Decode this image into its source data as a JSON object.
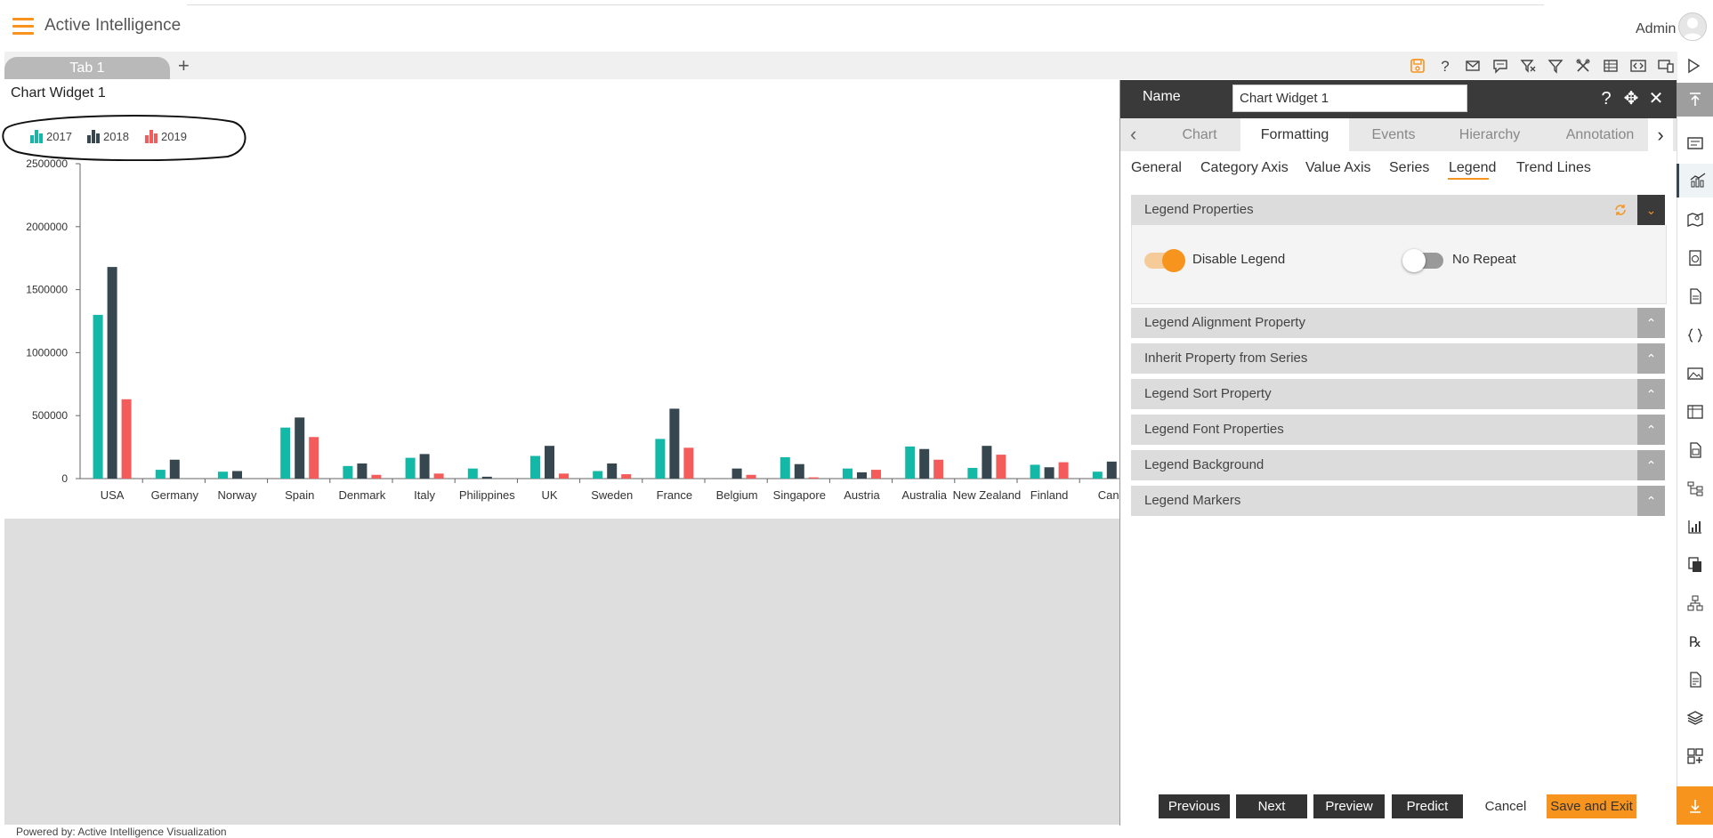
{
  "app": {
    "title": "Active Intelligence",
    "user": "Admin"
  },
  "tabs": [
    {
      "label": "Tab 1"
    }
  ],
  "tab_add": "+",
  "toolbar_icons": [
    "save-icon",
    "help-icon",
    "email-icon",
    "comment-icon",
    "clear-filter-icon",
    "filter-icon",
    "tools-icon",
    "table-icon",
    "embed-icon",
    "devices-icon",
    "play-icon"
  ],
  "widget": {
    "title": "Chart Widget 1"
  },
  "footer": {
    "powered": "Powered by: Active Intelligence Visualization"
  },
  "colors": {
    "accent": "#f7941d",
    "s2017": "#14b8a6",
    "s2018": "#37474f",
    "s2019": "#f45b5b"
  },
  "chart_data": {
    "type": "bar",
    "categories": [
      "USA",
      "Germany",
      "Norway",
      "Spain",
      "Denmark",
      "Italy",
      "Philippines",
      "UK",
      "Sweden",
      "France",
      "Belgium",
      "Singapore",
      "Austria",
      "Australia",
      "New Zealand",
      "Finland",
      "Cana"
    ],
    "series": [
      {
        "name": "2017",
        "values": [
          1300000,
          70000,
          55000,
          405000,
          100000,
          165000,
          80000,
          180000,
          60000,
          315000,
          0,
          170000,
          80000,
          255000,
          85000,
          110000,
          55000
        ]
      },
      {
        "name": "2018",
        "values": [
          1680000,
          150000,
          60000,
          485000,
          120000,
          195000,
          15000,
          260000,
          120000,
          555000,
          80000,
          115000,
          50000,
          235000,
          260000,
          90000,
          135000
        ]
      },
      {
        "name": "2019",
        "values": [
          630000,
          0,
          0,
          330000,
          30000,
          40000,
          0,
          40000,
          35000,
          245000,
          30000,
          10000,
          70000,
          150000,
          190000,
          130000,
          0
        ]
      }
    ],
    "yticks": [
      "0",
      "500000",
      "1000000",
      "1500000",
      "2000000",
      "2500000"
    ],
    "ylim": [
      0,
      2500000
    ],
    "legend": [
      "2017",
      "2018",
      "2019"
    ],
    "legend_placement": "top-left"
  },
  "panel": {
    "name_label": "Name",
    "name_value": "Chart Widget 1",
    "header_icons": {
      "help": "?",
      "move": "✥",
      "close": "✕"
    },
    "tabs": [
      "Chart",
      "Formatting",
      "Events",
      "Hierarchy",
      "Annotation"
    ],
    "active_tab": "Formatting",
    "subtabs": [
      "General",
      "Category Axis",
      "Value Axis",
      "Series",
      "Legend",
      "Trend Lines"
    ],
    "active_subtab": "Legend",
    "sections": {
      "legend_properties": "Legend Properties",
      "alignment": "Legend Alignment Property",
      "inherit": "Inherit Property from Series",
      "sort": "Legend Sort Property",
      "font": "Legend Font Properties",
      "background": "Legend Background",
      "markers": "Legend Markers"
    },
    "toggles": {
      "disable_legend": {
        "label": "Disable Legend",
        "on": true
      },
      "no_repeat": {
        "label": "No Repeat",
        "on": false
      }
    },
    "buttons": {
      "previous": "Previous",
      "next": "Next",
      "preview": "Preview",
      "predict": "Predict",
      "cancel": "Cancel",
      "save_exit": "Save and Exit"
    }
  },
  "rail_icons": [
    "scroll-top-icon",
    "text-widget-icon",
    "chart-widget-icon",
    "map-widget-icon",
    "gauge-widget-icon",
    "document-icon",
    "code-icon",
    "image-icon",
    "table-widget-icon",
    "report-icon",
    "tree-icon",
    "kpi-icon",
    "copy-icon",
    "hierarchy-icon",
    "rx-icon",
    "form-icon",
    "layers-icon",
    "add-widget-icon",
    "scroll-bottom-icon"
  ]
}
